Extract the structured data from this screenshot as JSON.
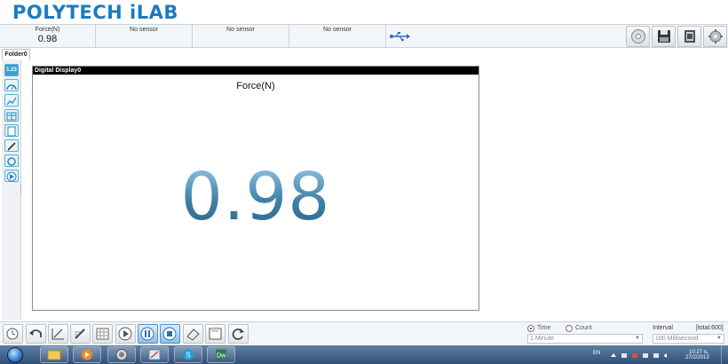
{
  "app": {
    "title": "POLYTECH iLAB"
  },
  "sensors": [
    {
      "label": "Force(N)",
      "value": "0.98"
    },
    {
      "label": "No sensor",
      "value": ""
    },
    {
      "label": "No sensor",
      "value": ""
    },
    {
      "label": "No sensor",
      "value": ""
    }
  ],
  "toolbar": {
    "buttons": [
      "disc-icon",
      "save-disk-icon",
      "book-icon",
      "settings-gear-icon"
    ]
  },
  "folder": {
    "tab_label": "Folder0"
  },
  "rail": {
    "digital_display_glyph": "1.23",
    "tools": [
      "digital-display-icon",
      "gauge-icon",
      "graph-icon",
      "table-icon",
      "notes-icon",
      "pen-icon",
      "camera-icon",
      "play-icon"
    ]
  },
  "display": {
    "header": "Digital Display0",
    "title": "Force(N)",
    "value": "0.98"
  },
  "bottom": {
    "time_label": "Time",
    "count_label": "Count",
    "time_selected": true,
    "duration_value": "1 Minute",
    "interval_label": "Interval",
    "total_label": "[total:600]",
    "interval_value": "100 Millisecond"
  },
  "taskbar": {
    "language": "EN",
    "time": "10:27 น.",
    "date": "27/2/2013"
  },
  "colors": {
    "brand": "#1b7cc0",
    "accent": "#3c9fd0",
    "value_text": "#4b8db5"
  }
}
